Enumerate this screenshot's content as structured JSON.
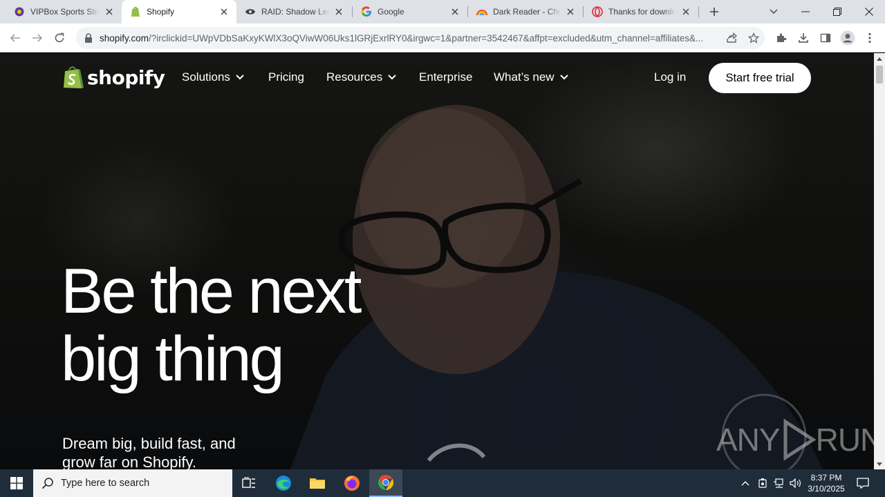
{
  "browser": {
    "tabs": [
      {
        "title": "VIPBox Sports Streams",
        "favicon": "vipbox-favicon",
        "active": false
      },
      {
        "title": "Shopify",
        "favicon": "shopify-favicon",
        "active": true
      },
      {
        "title": "RAID: Shadow Legends",
        "favicon": "raid-favicon",
        "active": false
      },
      {
        "title": "Google",
        "favicon": "google-favicon",
        "active": false
      },
      {
        "title": "Dark Reader - Chrome",
        "favicon": "dark-reader-favicon",
        "active": false
      },
      {
        "title": "Thanks for downloading",
        "favicon": "opera-favicon",
        "active": false
      }
    ],
    "url": {
      "host": "shopify.com",
      "rest": "/?irclickid=UWpVDbSaKxyKWlX3oQViwW06Uks1lGRjExrlRY0&irgwc=1&partner=3542467&affpt=excluded&utm_channel=affiliates&..."
    }
  },
  "page": {
    "brand": "shopify",
    "nav": {
      "solutions": "Solutions",
      "pricing": "Pricing",
      "resources": "Resources",
      "enterprise": "Enterprise",
      "whats_new": "What’s new",
      "login": "Log in",
      "cta": "Start free trial"
    },
    "hero": {
      "line1": "Be the next",
      "line2": "big thing",
      "sub": "Dream big, build fast, and grow far on Shopify."
    },
    "watermark": {
      "left": "ANY",
      "right": "RUN"
    }
  },
  "taskbar": {
    "search_placeholder": "Type here to search",
    "time": "8:37 PM",
    "date": "3/10/2025"
  },
  "colors": {
    "shopify_green": "#95bf47",
    "tabstrip": "#dee1e6",
    "taskbar": "#1f2d3a"
  }
}
